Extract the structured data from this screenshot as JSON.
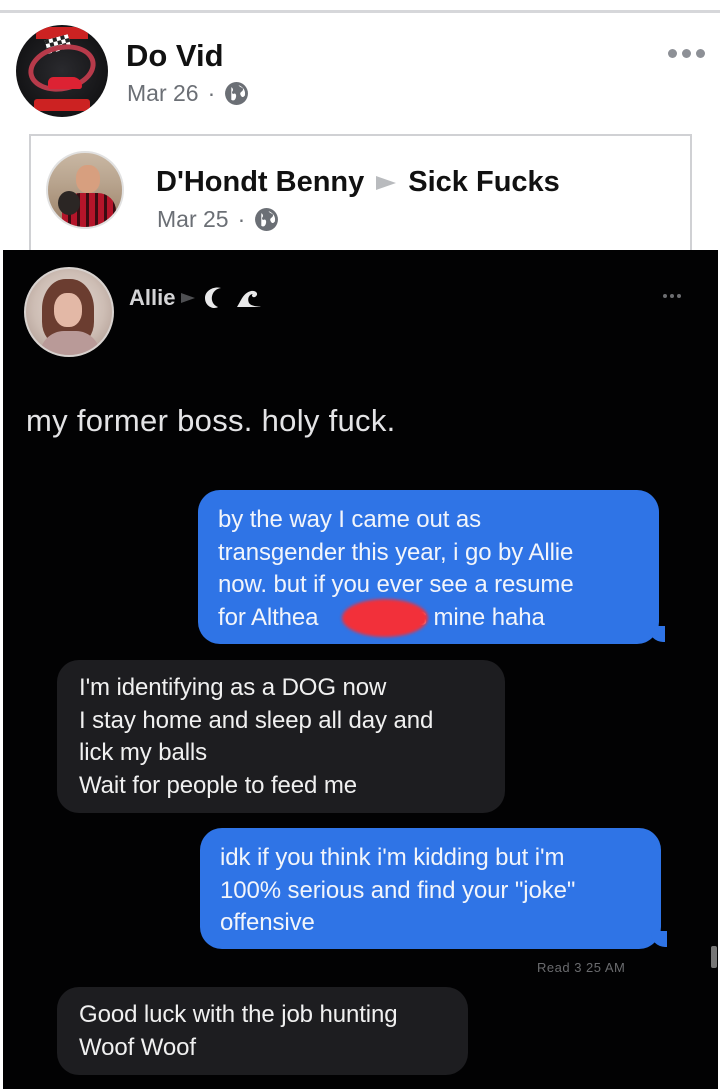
{
  "post": {
    "author": "Do Vid",
    "date": "Mar 26",
    "separator": "·",
    "privacy_icon": "globe-icon",
    "more_icon": "more-options-icon",
    "avatar_badge_text": "RACIST"
  },
  "shared_post": {
    "author": "D'Hondt Benny",
    "target": "Sick Fucks",
    "date": "Mar 25",
    "separator": "·",
    "arrow_icon": "right-arrow-icon",
    "privacy_icon": "globe-icon"
  },
  "screenshot": {
    "sender_name": "Allie",
    "name_emojis": [
      "moon-icon",
      "wave-icon"
    ],
    "caption": "my former boss. holy fuck.",
    "messages": [
      {
        "direction": "outgoing",
        "lines": [
          "by the way I came out as",
          "transgender this year, i go by Allie",
          "now. but if you ever see a resume",
          "for Althea        that's mine haha"
        ],
        "redacted": true
      },
      {
        "direction": "incoming",
        "lines": [
          "I'm identifying as a DOG now",
          "I stay home and sleep all day and",
          "lick my balls",
          "Wait for people to feed me"
        ]
      },
      {
        "direction": "outgoing",
        "lines": [
          "idk if you think i'm kidding but i'm",
          "100% serious and find your \"joke\"",
          "offensive"
        ]
      },
      {
        "direction": "incoming",
        "lines": [
          "Good luck with the job hunting",
          "Woof Woof"
        ]
      }
    ],
    "read_receipt": "Read 3 25 AM"
  },
  "colors": {
    "outgoing_bubble": "#2f74e6",
    "incoming_bubble": "#1d1d20",
    "redaction": "#f2303a",
    "screenshot_bg": "#020203"
  }
}
